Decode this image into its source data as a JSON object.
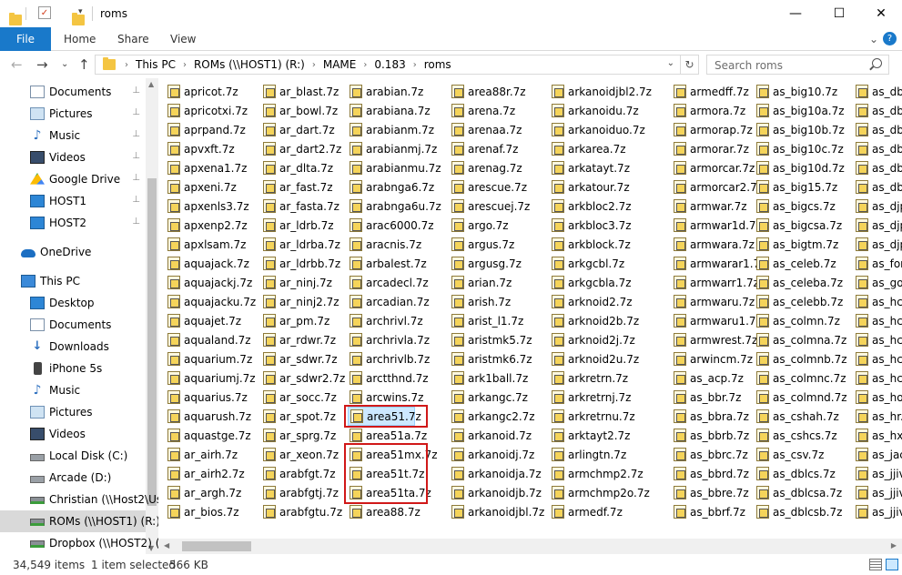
{
  "window": {
    "title": "roms",
    "minimize_glyph": "—",
    "maximize_glyph": "☐",
    "close_glyph": "✕"
  },
  "ribbon": {
    "tabs": [
      "File",
      "Home",
      "Share",
      "View"
    ],
    "chevron_glyph": "⌄",
    "help_glyph": "?"
  },
  "address": {
    "back_glyph": "←",
    "forward_glyph": "→",
    "recent_glyph": "⌄",
    "up_glyph": "↑",
    "crumbs": [
      "This PC",
      "ROMs (\\\\HOST1) (R:)",
      "MAME",
      "0.183",
      "roms"
    ],
    "crumb_separator": "›",
    "dropdown_glyph": "⌄",
    "refresh_glyph": "↻"
  },
  "search": {
    "placeholder": "Search roms",
    "value": ""
  },
  "nav_pane": {
    "items": [
      {
        "label": "Documents",
        "icon": "documents-icon",
        "pinned": true
      },
      {
        "label": "Pictures",
        "icon": "pictures-icon",
        "pinned": true
      },
      {
        "label": "Music",
        "icon": "music-icon",
        "pinned": true
      },
      {
        "label": "Videos",
        "icon": "videos-icon",
        "pinned": true
      },
      {
        "label": "Google Drive",
        "icon": "google-drive-icon",
        "pinned": true
      },
      {
        "label": "HOST1",
        "icon": "monitor-icon",
        "pinned": true
      },
      {
        "label": "HOST2",
        "icon": "monitor-icon",
        "pinned": true
      },
      {
        "label": "OneDrive",
        "icon": "onedrive-icon",
        "pinned": false
      },
      {
        "label": "This PC",
        "icon": "this-pc-icon",
        "pinned": false
      },
      {
        "label": "Desktop",
        "icon": "desktop-icon",
        "pinned": false
      },
      {
        "label": "Documents",
        "icon": "documents-icon",
        "pinned": false
      },
      {
        "label": "Downloads",
        "icon": "downloads-icon",
        "pinned": false
      },
      {
        "label": "iPhone 5s",
        "icon": "phone-icon",
        "pinned": false
      },
      {
        "label": "Music",
        "icon": "music-icon",
        "pinned": false
      },
      {
        "label": "Pictures",
        "icon": "pictures-icon",
        "pinned": false
      },
      {
        "label": "Videos",
        "icon": "videos-icon",
        "pinned": false
      },
      {
        "label": "Local Disk (C:)",
        "icon": "local-disk-icon",
        "pinned": false
      },
      {
        "label": "Arcade (D:)",
        "icon": "disk-icon",
        "pinned": false
      },
      {
        "label": "Christian (\\\\Host2\\Users)",
        "icon": "network-drive-icon",
        "pinned": false
      },
      {
        "label": "ROMs (\\\\HOST1) (R:)",
        "icon": "network-drive-icon",
        "pinned": false,
        "selected": true
      },
      {
        "label": "Dropbox (\\\\HOST2) (Z:)",
        "icon": "network-drive-icon",
        "pinned": false
      }
    ],
    "pin_glyph": "📌"
  },
  "files": {
    "columns": [
      [
        "apricot.7z",
        "apricotxi.7z",
        "aprpand.7z",
        "apvxft.7z",
        "apxena1.7z",
        "apxeni.7z",
        "apxenls3.7z",
        "apxenp2.7z",
        "apxlsam.7z",
        "aquajack.7z",
        "aquajackj.7z",
        "aquajacku.7z",
        "aquajet.7z",
        "aqualand.7z",
        "aquarium.7z",
        "aquariumj.7z",
        "aquarius.7z",
        "aquarush.7z",
        "aquastge.7z",
        "ar_airh.7z",
        "ar_airh2.7z",
        "ar_argh.7z",
        "ar_bios.7z"
      ],
      [
        "ar_blast.7z",
        "ar_bowl.7z",
        "ar_dart.7z",
        "ar_dart2.7z",
        "ar_dlta.7z",
        "ar_fast.7z",
        "ar_fasta.7z",
        "ar_ldrb.7z",
        "ar_ldrba.7z",
        "ar_ldrbb.7z",
        "ar_ninj.7z",
        "ar_ninj2.7z",
        "ar_pm.7z",
        "ar_rdwr.7z",
        "ar_sdwr.7z",
        "ar_sdwr2.7z",
        "ar_socc.7z",
        "ar_spot.7z",
        "ar_sprg.7z",
        "ar_xeon.7z",
        "arabfgt.7z",
        "arabfgtj.7z",
        "arabfgtu.7z"
      ],
      [
        "arabian.7z",
        "arabiana.7z",
        "arabianm.7z",
        "arabianmj.7z",
        "arabianmu.7z",
        "arabnga6.7z",
        "arabnga6u.7z",
        "arac6000.7z",
        "aracnis.7z",
        "arbalest.7z",
        "arcadecl.7z",
        "arcadian.7z",
        "archrivl.7z",
        "archrivla.7z",
        "archrivlb.7z",
        "arctthnd.7z",
        "arcwins.7z",
        "area51.7z",
        "area51a.7z",
        "area51mx.7z",
        "area51t.7z",
        "area51ta.7z",
        "area88.7z"
      ],
      [
        "area88r.7z",
        "arena.7z",
        "arenaa.7z",
        "arenaf.7z",
        "arenag.7z",
        "arescue.7z",
        "arescuej.7z",
        "argo.7z",
        "argus.7z",
        "argusg.7z",
        "arian.7z",
        "arish.7z",
        "arist_l1.7z",
        "aristmk5.7z",
        "aristmk6.7z",
        "ark1ball.7z",
        "arkangc.7z",
        "arkangc2.7z",
        "arkanoid.7z",
        "arkanoidj.7z",
        "arkanoidja.7z",
        "arkanoidjb.7z",
        "arkanoidjbl.7z"
      ],
      [
        "arkanoidjbl2.7z",
        "arkanoidu.7z",
        "arkanoiduo.7z",
        "arkarea.7z",
        "arkatayt.7z",
        "arkatour.7z",
        "arkbloc2.7z",
        "arkbloc3.7z",
        "arkblock.7z",
        "arkgcbl.7z",
        "arkgcbla.7z",
        "arknoid2.7z",
        "arknoid2b.7z",
        "arknoid2j.7z",
        "arknoid2u.7z",
        "arkretrn.7z",
        "arkretrnj.7z",
        "arkretrnu.7z",
        "arktayt2.7z",
        "arlingtn.7z",
        "armchmp2.7z",
        "armchmp2o.7z",
        "armedf.7z"
      ],
      [
        "armedff.7z",
        "armora.7z",
        "armorap.7z",
        "armorar.7z",
        "armorcar.7z",
        "armorcar2.7z",
        "armwar.7z",
        "armwar1d.7z",
        "armwara.7z",
        "armwarar1.7z",
        "armwarr1.7z",
        "armwaru.7z",
        "armwaru1.7z",
        "armwrest.7z",
        "arwincm.7z",
        "as_acp.7z",
        "as_bbr.7z",
        "as_bbra.7z",
        "as_bbrb.7z",
        "as_bbrc.7z",
        "as_bbrd.7z",
        "as_bbre.7z",
        "as_bbrf.7z"
      ],
      [
        "as_big10.7z",
        "as_big10a.7z",
        "as_big10b.7z",
        "as_big10c.7z",
        "as_big10d.7z",
        "as_big15.7z",
        "as_bigcs.7z",
        "as_bigcsa.7z",
        "as_bigtm.7z",
        "as_celeb.7z",
        "as_celeba.7z",
        "as_celebb.7z",
        "as_colmn.7z",
        "as_colmna.7z",
        "as_colmnb.7z",
        "as_colmnc.7z",
        "as_colmnd.7z",
        "as_cshah.7z",
        "as_cshcs.7z",
        "as_csv.7z",
        "as_dblcs.7z",
        "as_dblcsa.7z",
        "as_dblcsb.7z"
      ],
      [
        "as_dbl",
        "as_dbl",
        "as_dbl",
        "as_dbl",
        "as_dbl",
        "as_dbl",
        "as_djp",
        "as_djp",
        "as_djp",
        "as_for",
        "as_got",
        "as_hc.",
        "as_hca",
        "as_hcb",
        "as_hcc",
        "as_hcc",
        "as_hog",
        "as_hr.",
        "as_hxr",
        "as_jac",
        "as_jjiv",
        "as_jjiv",
        "as_jjiv"
      ]
    ],
    "selected": "area51.7z",
    "highlighted": [
      "area51mx.7z",
      "area51t.7z",
      "area51ta.7z"
    ]
  },
  "status": {
    "item_count": "34,549 items",
    "selection": "1 item selected",
    "size": "566 KB"
  }
}
